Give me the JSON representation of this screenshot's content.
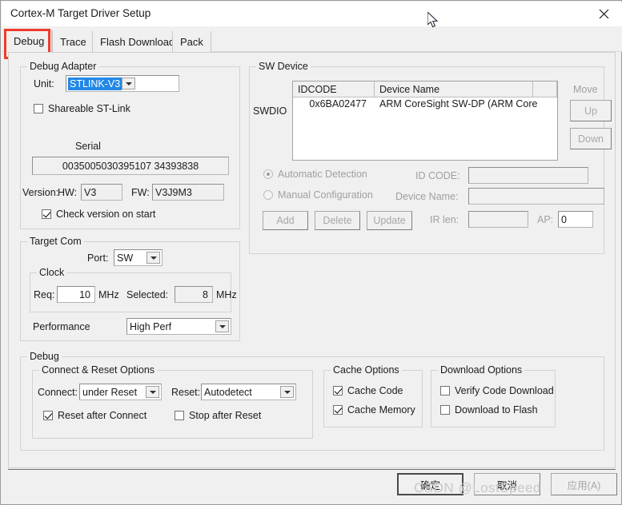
{
  "window": {
    "title": "Cortex-M Target Driver Setup",
    "close_icon": "close-icon"
  },
  "tabs": [
    {
      "label": "Debug",
      "active": true
    },
    {
      "label": "Trace",
      "active": false
    },
    {
      "label": "Flash Download",
      "active": false
    },
    {
      "label": "Pack",
      "active": false
    }
  ],
  "debug_adapter": {
    "legend": "Debug Adapter",
    "unit_label": "Unit:",
    "unit_value": "STLINK-V3",
    "shareable_label": "Shareable ST-Link",
    "shareable_checked": false,
    "serial_label": "Serial",
    "serial_value": "0035005030395107 34393838",
    "version_label": "Version:",
    "hw_label": "HW:",
    "hw_value": "V3",
    "fw_label": "FW:",
    "fw_value": "V3J9M3",
    "check_version_label": "Check version on start",
    "check_version_checked": true
  },
  "sw_device": {
    "legend": "SW Device",
    "swdio_label": "SWDIO",
    "columns": [
      "IDCODE",
      "Device Name"
    ],
    "rows": [
      {
        "idcode": "0x6BA02477",
        "device_name": "ARM CoreSight SW-DP (ARM Core"
      }
    ],
    "move_label": "Move",
    "up_label": "Up",
    "down_label": "Down",
    "automatic_detection_label": "Automatic Detection",
    "automatic_detection_selected": true,
    "manual_configuration_label": "Manual Configuration",
    "manual_configuration_selected": false,
    "id_code_label": "ID CODE:",
    "id_code_value": "",
    "device_name_label": "Device Name:",
    "device_name_value": "",
    "add_label": "Add",
    "delete_label": "Delete",
    "update_label": "Update",
    "ir_len_label": "IR len:",
    "ir_len_value": "",
    "ap_label": "AP:",
    "ap_value": "0"
  },
  "target_com": {
    "legend": "Target Com",
    "port_label": "Port:",
    "port_value": "SW",
    "clock_legend": "Clock",
    "req_label": "Req:",
    "req_value": "10",
    "req_unit": "MHz",
    "selected_label": "Selected:",
    "selected_value": "8",
    "selected_unit": "MHz",
    "performance_label": "Performance",
    "performance_value": "High Perf"
  },
  "debug_section": {
    "legend": "Debug",
    "connect_reset": {
      "legend": "Connect & Reset Options",
      "connect_label": "Connect:",
      "connect_value": "under Reset",
      "reset_label": "Reset:",
      "reset_value": "Autodetect",
      "reset_after_connect_label": "Reset after Connect",
      "reset_after_connect_checked": true,
      "stop_after_reset_label": "Stop after Reset",
      "stop_after_reset_checked": false
    },
    "cache_options": {
      "legend": "Cache Options",
      "cache_code_label": "Cache Code",
      "cache_code_checked": true,
      "cache_memory_label": "Cache Memory",
      "cache_memory_checked": true
    },
    "download_options": {
      "legend": "Download Options",
      "verify_code_download_label": "Verify Code Download",
      "verify_code_download_checked": false,
      "download_to_flash_label": "Download to Flash",
      "download_to_flash_checked": false
    }
  },
  "footer": {
    "ok_label": "确定",
    "cancel_label": "取消",
    "apply_label": "应用(A)",
    "apply_disabled": true,
    "watermark": "CSDN @LostSpeed"
  },
  "colors": {
    "highlight_red": "#ef3b2d",
    "selection_blue": "#2287e6",
    "window_bg": "#f0f0f0"
  }
}
